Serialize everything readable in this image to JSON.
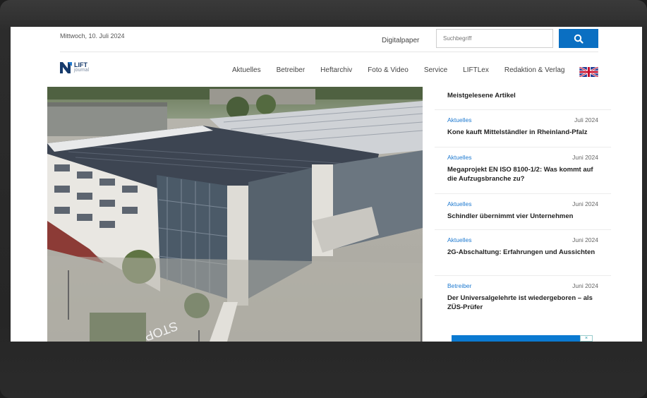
{
  "topbar": {
    "date": "Mittwoch, 10. Juli 2024",
    "digitalpaper": "Digitalpaper",
    "search_placeholder": "Suchbegriff",
    "search_icon": "search-icon"
  },
  "logo": {
    "line1": "LIFT",
    "line2": "journal"
  },
  "nav": {
    "items": [
      "Aktuelles",
      "Betreiber",
      "Heftarchiv",
      "Foto & Video",
      "Service",
      "LIFTLex",
      "Redaktion & Verlag"
    ],
    "language_icon": "uk-flag-icon"
  },
  "sidebar": {
    "title": "Meistgelesene Artikel",
    "articles": [
      {
        "category": "Aktuelles",
        "date": "Juli 2024",
        "headline": "Kone kauft Mittelständler in Rheinland-Pfalz"
      },
      {
        "category": "Aktuelles",
        "date": "Juni 2024",
        "headline": "Megaprojekt EN ISO 8100-1/2: Was kommt auf die Aufzugsbranche zu?"
      },
      {
        "category": "Aktuelles",
        "date": "Juni 2024",
        "headline": "Schindler übernimmt vier Unternehmen"
      },
      {
        "category": "Aktuelles",
        "date": "Juni 2024",
        "headline": "2G-Abschaltung: Erfahrungen und Aussichten"
      },
      {
        "category": "Betreiber",
        "date": "Juni 2024",
        "headline": "Der Universalgelehrte ist wiedergeboren – als ZÜS-Prüfer"
      }
    ]
  },
  "hero": {
    "road_marking": "STOP"
  },
  "colors": {
    "accent": "#0a6fc2",
    "link": "#1f7ad0",
    "frame": "#2a2a2a"
  }
}
